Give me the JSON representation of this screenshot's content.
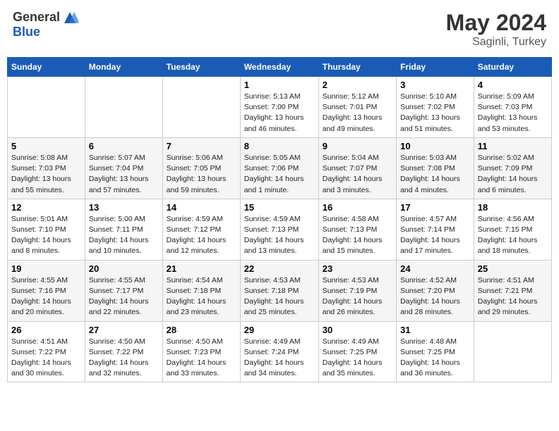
{
  "header": {
    "logo_general": "General",
    "logo_blue": "Blue",
    "month_year": "May 2024",
    "location": "Saginli, Turkey"
  },
  "days_of_week": [
    "Sunday",
    "Monday",
    "Tuesday",
    "Wednesday",
    "Thursday",
    "Friday",
    "Saturday"
  ],
  "weeks": [
    [
      {
        "day": "",
        "info": ""
      },
      {
        "day": "",
        "info": ""
      },
      {
        "day": "",
        "info": ""
      },
      {
        "day": "1",
        "info": "Sunrise: 5:13 AM\nSunset: 7:00 PM\nDaylight: 13 hours\nand 46 minutes."
      },
      {
        "day": "2",
        "info": "Sunrise: 5:12 AM\nSunset: 7:01 PM\nDaylight: 13 hours\nand 49 minutes."
      },
      {
        "day": "3",
        "info": "Sunrise: 5:10 AM\nSunset: 7:02 PM\nDaylight: 13 hours\nand 51 minutes."
      },
      {
        "day": "4",
        "info": "Sunrise: 5:09 AM\nSunset: 7:03 PM\nDaylight: 13 hours\nand 53 minutes."
      }
    ],
    [
      {
        "day": "5",
        "info": "Sunrise: 5:08 AM\nSunset: 7:03 PM\nDaylight: 13 hours\nand 55 minutes."
      },
      {
        "day": "6",
        "info": "Sunrise: 5:07 AM\nSunset: 7:04 PM\nDaylight: 13 hours\nand 57 minutes."
      },
      {
        "day": "7",
        "info": "Sunrise: 5:06 AM\nSunset: 7:05 PM\nDaylight: 13 hours\nand 59 minutes."
      },
      {
        "day": "8",
        "info": "Sunrise: 5:05 AM\nSunset: 7:06 PM\nDaylight: 14 hours\nand 1 minute."
      },
      {
        "day": "9",
        "info": "Sunrise: 5:04 AM\nSunset: 7:07 PM\nDaylight: 14 hours\nand 3 minutes."
      },
      {
        "day": "10",
        "info": "Sunrise: 5:03 AM\nSunset: 7:08 PM\nDaylight: 14 hours\nand 4 minutes."
      },
      {
        "day": "11",
        "info": "Sunrise: 5:02 AM\nSunset: 7:09 PM\nDaylight: 14 hours\nand 6 minutes."
      }
    ],
    [
      {
        "day": "12",
        "info": "Sunrise: 5:01 AM\nSunset: 7:10 PM\nDaylight: 14 hours\nand 8 minutes."
      },
      {
        "day": "13",
        "info": "Sunrise: 5:00 AM\nSunset: 7:11 PM\nDaylight: 14 hours\nand 10 minutes."
      },
      {
        "day": "14",
        "info": "Sunrise: 4:59 AM\nSunset: 7:12 PM\nDaylight: 14 hours\nand 12 minutes."
      },
      {
        "day": "15",
        "info": "Sunrise: 4:59 AM\nSunset: 7:13 PM\nDaylight: 14 hours\nand 13 minutes."
      },
      {
        "day": "16",
        "info": "Sunrise: 4:58 AM\nSunset: 7:13 PM\nDaylight: 14 hours\nand 15 minutes."
      },
      {
        "day": "17",
        "info": "Sunrise: 4:57 AM\nSunset: 7:14 PM\nDaylight: 14 hours\nand 17 minutes."
      },
      {
        "day": "18",
        "info": "Sunrise: 4:56 AM\nSunset: 7:15 PM\nDaylight: 14 hours\nand 18 minutes."
      }
    ],
    [
      {
        "day": "19",
        "info": "Sunrise: 4:55 AM\nSunset: 7:16 PM\nDaylight: 14 hours\nand 20 minutes."
      },
      {
        "day": "20",
        "info": "Sunrise: 4:55 AM\nSunset: 7:17 PM\nDaylight: 14 hours\nand 22 minutes."
      },
      {
        "day": "21",
        "info": "Sunrise: 4:54 AM\nSunset: 7:18 PM\nDaylight: 14 hours\nand 23 minutes."
      },
      {
        "day": "22",
        "info": "Sunrise: 4:53 AM\nSunset: 7:18 PM\nDaylight: 14 hours\nand 25 minutes."
      },
      {
        "day": "23",
        "info": "Sunrise: 4:53 AM\nSunset: 7:19 PM\nDaylight: 14 hours\nand 26 minutes."
      },
      {
        "day": "24",
        "info": "Sunrise: 4:52 AM\nSunset: 7:20 PM\nDaylight: 14 hours\nand 28 minutes."
      },
      {
        "day": "25",
        "info": "Sunrise: 4:51 AM\nSunset: 7:21 PM\nDaylight: 14 hours\nand 29 minutes."
      }
    ],
    [
      {
        "day": "26",
        "info": "Sunrise: 4:51 AM\nSunset: 7:22 PM\nDaylight: 14 hours\nand 30 minutes."
      },
      {
        "day": "27",
        "info": "Sunrise: 4:50 AM\nSunset: 7:22 PM\nDaylight: 14 hours\nand 32 minutes."
      },
      {
        "day": "28",
        "info": "Sunrise: 4:50 AM\nSunset: 7:23 PM\nDaylight: 14 hours\nand 33 minutes."
      },
      {
        "day": "29",
        "info": "Sunrise: 4:49 AM\nSunset: 7:24 PM\nDaylight: 14 hours\nand 34 minutes."
      },
      {
        "day": "30",
        "info": "Sunrise: 4:49 AM\nSunset: 7:25 PM\nDaylight: 14 hours\nand 35 minutes."
      },
      {
        "day": "31",
        "info": "Sunrise: 4:48 AM\nSunset: 7:25 PM\nDaylight: 14 hours\nand 36 minutes."
      },
      {
        "day": "",
        "info": ""
      }
    ]
  ]
}
